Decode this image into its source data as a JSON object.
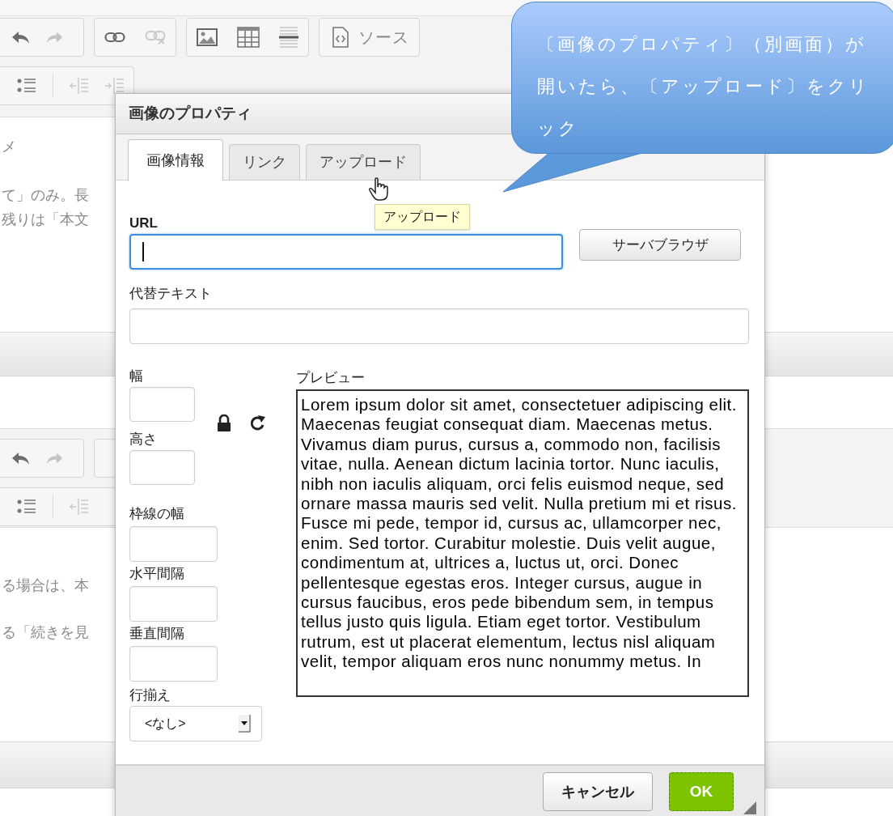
{
  "editor": {
    "source_button": "ソース",
    "upper_lines": [
      "メ",
      "て」のみ。長",
      "残りは「本文"
    ],
    "lower_lines": [
      "る場合は、本",
      "る「続きを見"
    ]
  },
  "dialog": {
    "title": "画像のプロパティ",
    "tabs": [
      {
        "label": "画像情報",
        "selected": true
      },
      {
        "label": "リンク",
        "selected": false
      },
      {
        "label": "アップロード",
        "selected": false
      }
    ],
    "tooltip": "アップロード",
    "url": {
      "label": "URL",
      "focused": true
    },
    "browse_button": "サーバブラウザ",
    "alt_text": {
      "label": "代替テキスト",
      "focused": false
    },
    "size_fields": [
      {
        "label": "幅"
      },
      {
        "label": "高さ"
      }
    ],
    "spacing_fields": [
      {
        "label": "枠線の幅"
      },
      {
        "label": "水平間隔"
      },
      {
        "label": "垂直間隔"
      }
    ],
    "align": {
      "label": "行揃え",
      "value": "<なし>"
    },
    "preview": {
      "label": "プレビュー",
      "text": "Lorem ipsum dolor sit amet, consectetuer adipiscing elit. Maecenas feugiat consequat diam. Maecenas metus. Vivamus diam purus, cursus a, commodo non, facilisis vitae, nulla. Aenean dictum lacinia tortor. Nunc iaculis, nibh non iaculis aliquam, orci felis euismod neque, sed ornare massa mauris sed velit. Nulla pretium mi et risus. Fusce mi pede, tempor id, cursus ac, ullamcorper nec, enim. Sed tortor. Curabitur molestie. Duis velit augue, condimentum at, ultrices a, luctus ut, orci. Donec pellentesque egestas eros. Integer cursus, augue in cursus faucibus, eros pede bibendum sem, in tempus tellus justo quis ligula. Etiam eget tortor. Vestibulum rutrum, est ut placerat elementum, lectus nisl aliquam velit, tempor aliquam eros nunc nonummy metus. In"
    },
    "buttons": [
      {
        "label": "キャンセル",
        "kind": "secondary"
      },
      {
        "label": "OK",
        "kind": "primary"
      }
    ]
  },
  "callout": {
    "text": "〔画像のプロパティ〕（別画面）が開いたら、〔アップロード〕をクリック"
  }
}
